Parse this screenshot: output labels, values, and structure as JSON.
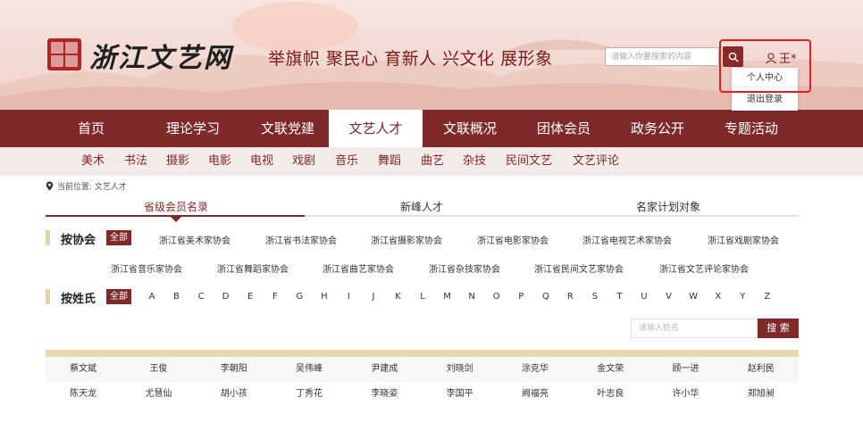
{
  "header": {
    "logo_text": "浙江文艺网",
    "slogan": "举旗帜 聚民心 育新人 兴文化 展形象",
    "search_placeholder": "请输入你要搜索的内容",
    "user_name": "王*",
    "dropdown": [
      "个人中心",
      "退出登录"
    ]
  },
  "nav": {
    "items": [
      "首页",
      "理论学习",
      "文联党建",
      "文艺人才",
      "文联概况",
      "团体会员",
      "政务公开",
      "专题活动"
    ],
    "active": "文艺人才"
  },
  "subnav": [
    "美术",
    "书法",
    "摄影",
    "电影",
    "电视",
    "戏剧",
    "音乐",
    "舞蹈",
    "曲艺",
    "杂技",
    "民间文艺",
    "文艺评论"
  ],
  "breadcrumb": "当前位置: 文艺人才",
  "tabs": [
    "省级会员名录",
    "新峰人才",
    "名家计划对象"
  ],
  "filter_association": {
    "label": "按协会",
    "all_label": "全部",
    "options_row1": [
      "浙江省美术家协会",
      "浙江省书法家协会",
      "浙江省摄影家协会",
      "浙江省电影家协会",
      "浙江省电视艺术家协会",
      "浙江省戏剧家协会"
    ],
    "options_row2": [
      "浙江省音乐家协会",
      "浙江省舞蹈家协会",
      "浙江省曲艺家协会",
      "浙江省杂技家协会",
      "浙江省民间文艺家协会",
      "浙江省文艺评论家协会"
    ]
  },
  "filter_surname": {
    "label": "按姓氏",
    "all_label": "全部",
    "letters": [
      "A",
      "B",
      "C",
      "D",
      "E",
      "F",
      "G",
      "H",
      "I",
      "J",
      "K",
      "L",
      "M",
      "N",
      "O",
      "P",
      "Q",
      "R",
      "S",
      "T",
      "U",
      "V",
      "W",
      "X",
      "Y",
      "Z"
    ]
  },
  "name_search": {
    "placeholder": "请输入姓名",
    "button_label": "搜 索"
  },
  "members": [
    [
      "蔡文斌",
      "王俊",
      "李朝阳",
      "吴伟峰",
      "尹建成",
      "刘晓剑",
      "涂克华",
      "金文荣",
      "顾一进",
      "赵利民"
    ],
    [
      "陈天龙",
      "尤慧仙",
      "胡小孩",
      "丁秀花",
      "李晓姿",
      "李国平",
      "阙福亮",
      "叶志良",
      "许小华",
      "郑旭昶"
    ]
  ],
  "colors": {
    "primary": "#7e2a2a",
    "highlight": "#e02020",
    "accent_bar": "#e6d3a6"
  },
  "icons": [
    "search-icon",
    "user-icon",
    "location-pin-icon"
  ]
}
